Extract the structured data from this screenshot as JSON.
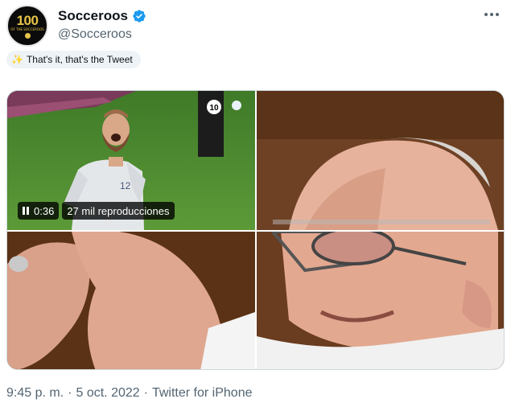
{
  "avatar": {
    "number": "100",
    "subtitle": "OF THE SOCCEROOS"
  },
  "author": {
    "display_name": "Socceroos",
    "handle": "@Socceroos",
    "verified": true
  },
  "tweet": {
    "text": "That's it, that's the Tweet",
    "icon": "sparkles-icon"
  },
  "video": {
    "time": "0:36",
    "views": "27 mil reproducciones",
    "channel_badge": "10"
  },
  "meta": {
    "time": "9:45 p. m.",
    "separator": "·",
    "date": "5 oct. 2022",
    "separator2": "·",
    "source": "Twitter for iPhone"
  },
  "colors": {
    "verified": "#1d9bf0",
    "text_secondary": "#536471",
    "pitch_green": "#4a8a2c"
  }
}
